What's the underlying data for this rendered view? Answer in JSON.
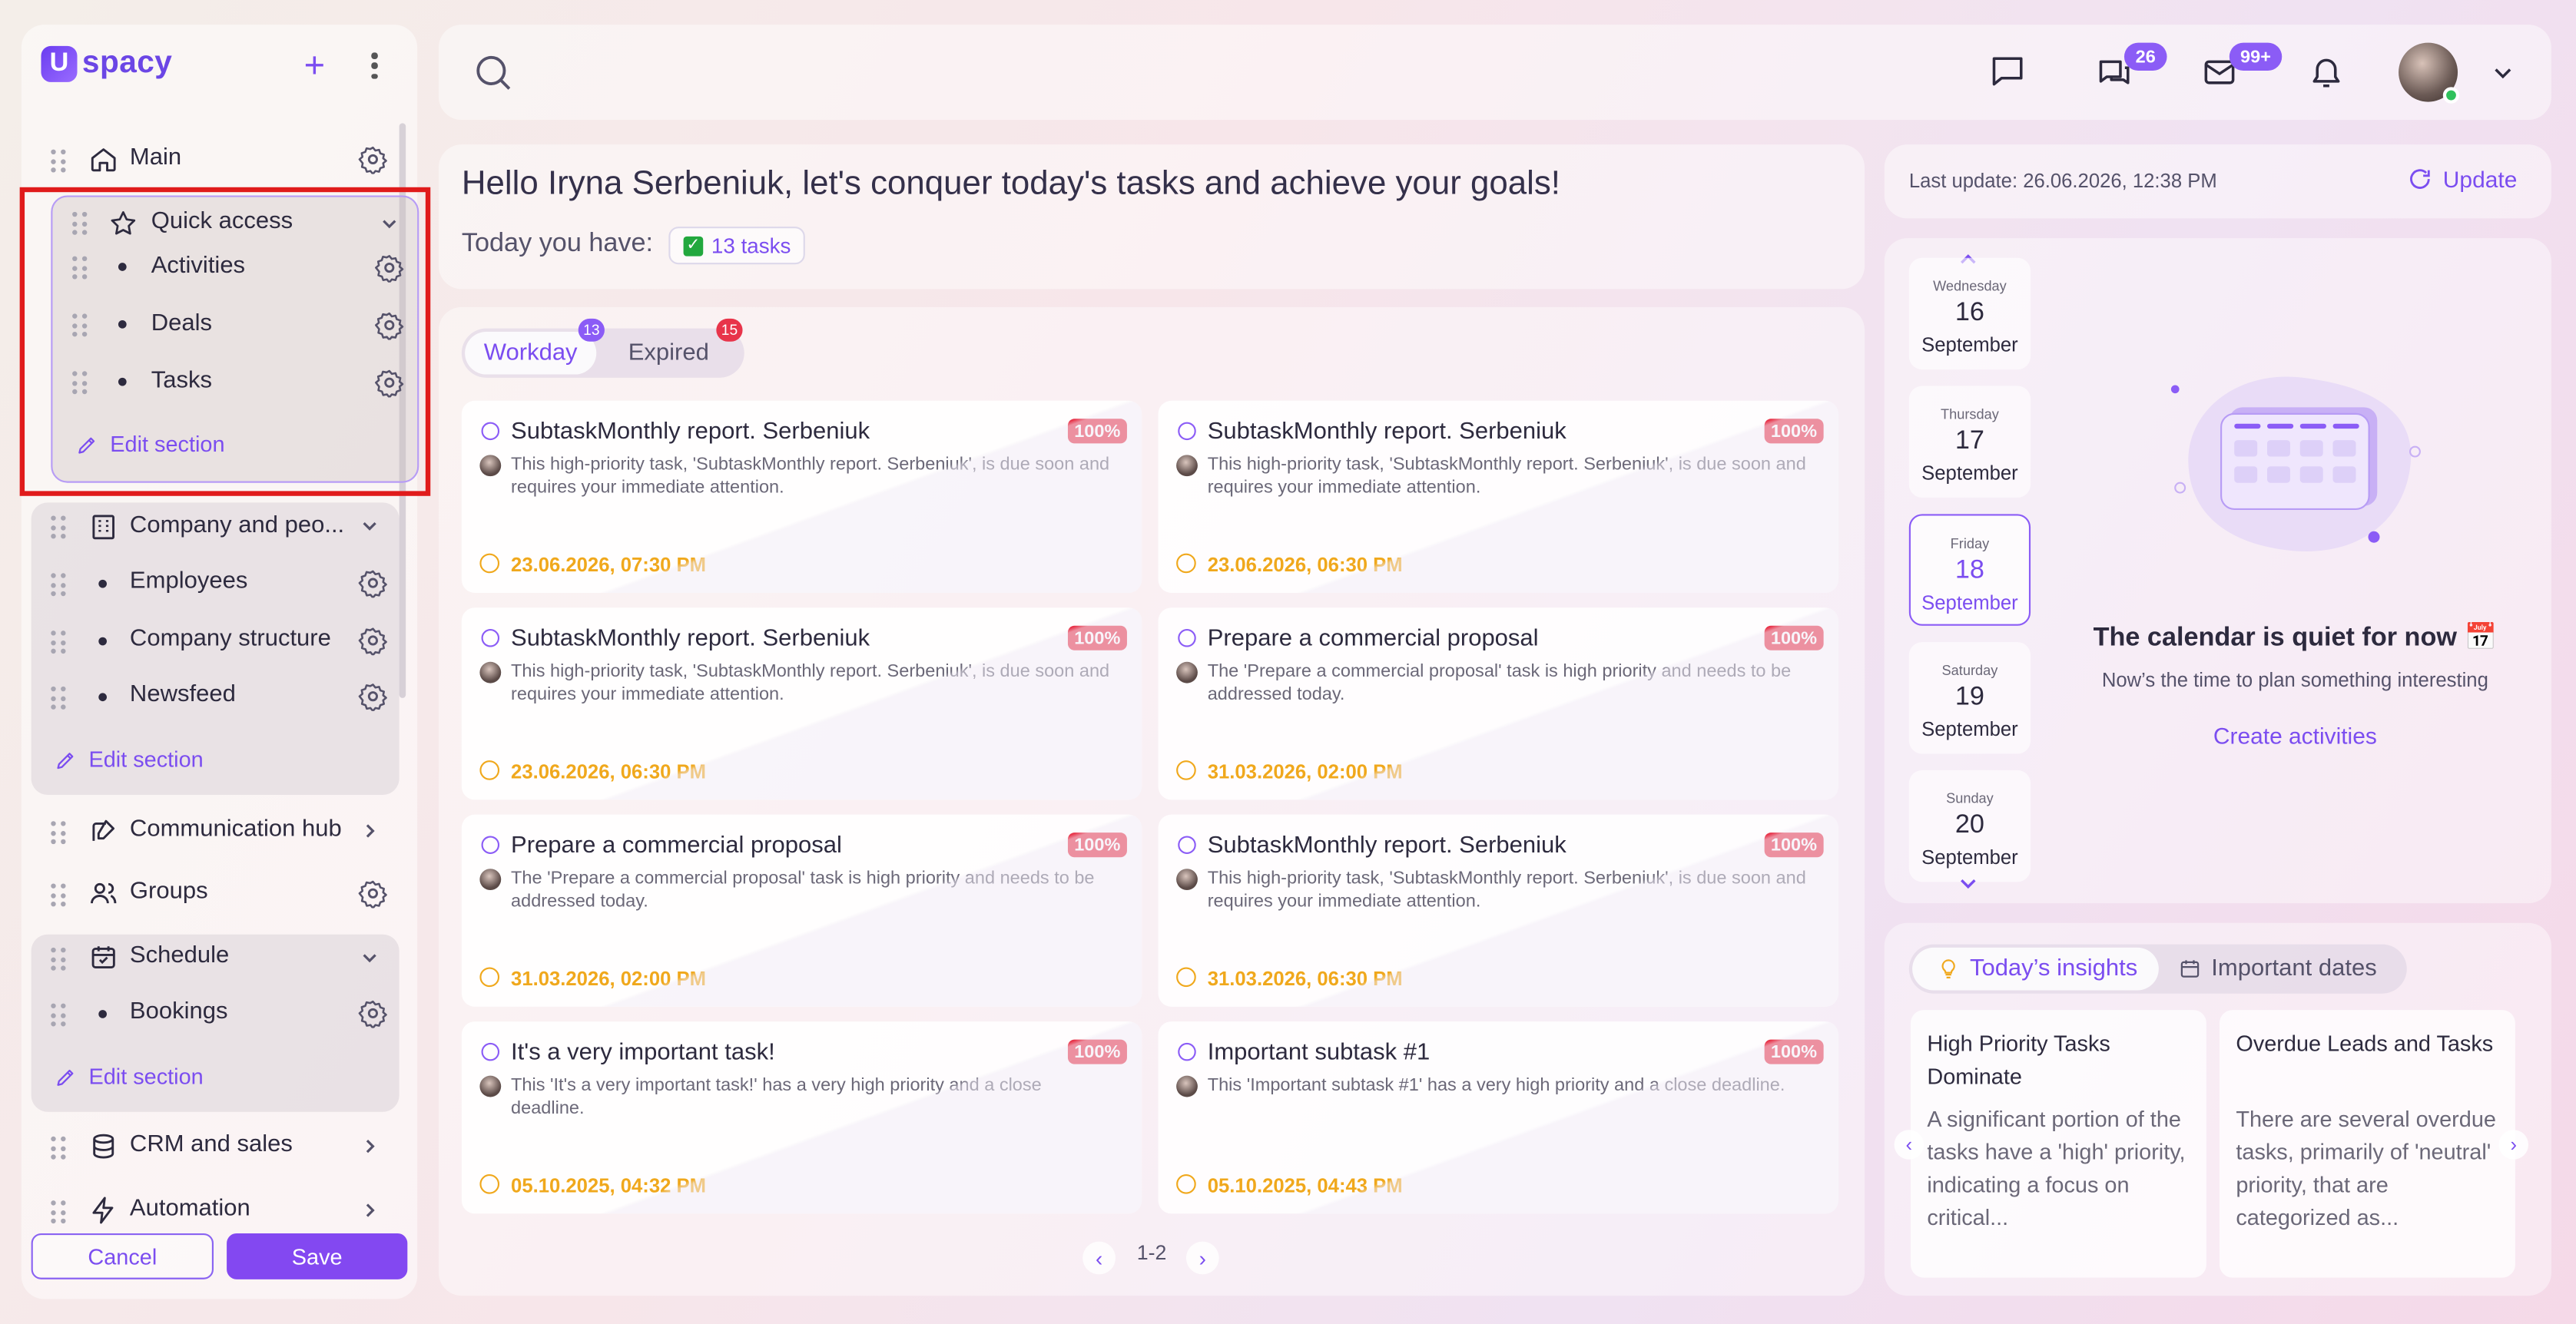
{
  "brand": {
    "logo_letter": "U",
    "logo_text": "spacy"
  },
  "sidebar": {
    "items": [
      {
        "label": "Main"
      },
      {
        "label": "Quick access",
        "children": [
          {
            "label": "Activities"
          },
          {
            "label": "Deals"
          },
          {
            "label": "Tasks"
          }
        ],
        "edit_label": "Edit section"
      },
      {
        "label": "Company and peo...",
        "children": [
          {
            "label": "Employees"
          },
          {
            "label": "Company structure"
          },
          {
            "label": "Newsfeed"
          }
        ],
        "edit_label": "Edit section"
      },
      {
        "label": "Communication hub"
      },
      {
        "label": "Groups"
      },
      {
        "label": "Schedule",
        "children": [
          {
            "label": "Bookings"
          }
        ],
        "edit_label": "Edit section"
      },
      {
        "label": "CRM and sales"
      },
      {
        "label": "Automation"
      }
    ],
    "cancel_label": "Cancel",
    "save_label": "Save"
  },
  "topbar": {
    "chat_badge": "26",
    "mail_badge": "99+"
  },
  "greeting": {
    "title": "Hello Iryna Serbeniuk, let's conquer today's tasks and achieve your goals!",
    "today_label": "Today you have:",
    "tasks_pill": "13 tasks"
  },
  "tasks": {
    "tabs": [
      {
        "label": "Workday",
        "badge": "13"
      },
      {
        "label": "Expired",
        "badge": "15"
      }
    ],
    "cards": [
      {
        "title": "SubtaskMonthly report. Serbeniuk",
        "percent": "100%",
        "desc": "This high-priority task, 'SubtaskMonthly report. Serbeniuk', is due soon and requires your immediate attention.",
        "date": "23.06.2026, 07:30 PM"
      },
      {
        "title": "SubtaskMonthly report. Serbeniuk",
        "percent": "100%",
        "desc": "This high-priority task, 'SubtaskMonthly report. Serbeniuk', is due soon and requires your immediate attention.",
        "date": "23.06.2026, 06:30 PM"
      },
      {
        "title": "SubtaskMonthly report. Serbeniuk",
        "percent": "100%",
        "desc": "This high-priority task, 'SubtaskMonthly report. Serbeniuk', is due soon and requires your immediate attention.",
        "date": "23.06.2026, 06:30 PM"
      },
      {
        "title": "Prepare a commercial proposal",
        "percent": "100%",
        "desc": "The 'Prepare a commercial proposal' task is high priority and needs to be addressed today.",
        "date": "31.03.2026, 02:00 PM"
      },
      {
        "title": "Prepare a commercial proposal",
        "percent": "100%",
        "desc": "The 'Prepare a commercial proposal' task is high priority and needs to be addressed today.",
        "date": "31.03.2026, 02:00 PM"
      },
      {
        "title": "SubtaskMonthly report. Serbeniuk",
        "percent": "100%",
        "desc": "This high-priority task, 'SubtaskMonthly report. Serbeniuk', is due soon and requires your immediate attention.",
        "date": "31.03.2026, 06:30 PM"
      },
      {
        "title": "It's a very important task!",
        "percent": "100%",
        "desc": "This 'It's a very important task!' has a very high priority and a close deadline.",
        "date": "05.10.2025, 04:32 PM"
      },
      {
        "title": "Important subtask #1",
        "percent": "100%",
        "desc": "This 'Important subtask #1' has a very high priority and a close deadline.",
        "date": "05.10.2025, 04:43 PM"
      }
    ],
    "pager": "1-2"
  },
  "update": {
    "last_update": "Last update: 26.06.2026, 12:38 PM",
    "button": "Update"
  },
  "calendar": {
    "days": [
      {
        "weekday": "Wednesday",
        "day": "16",
        "month": "September"
      },
      {
        "weekday": "Thursday",
        "day": "17",
        "month": "September"
      },
      {
        "weekday": "Friday",
        "day": "18",
        "month": "September"
      },
      {
        "weekday": "Saturday",
        "day": "19",
        "month": "September"
      },
      {
        "weekday": "Sunday",
        "day": "20",
        "month": "September"
      }
    ],
    "empty_title": "The calendar is quiet for now 📅",
    "empty_sub": "Now’s the time to plan something interesting",
    "create_link": "Create activities"
  },
  "insights": {
    "tabs": [
      {
        "label": "Today’s insights"
      },
      {
        "label": "Important dates"
      }
    ],
    "cards": [
      {
        "title": "High Priority Tasks Dominate",
        "body": "A significant portion of the tasks have a 'high' priority, indicating a focus on critical..."
      },
      {
        "title": "Overdue Leads and Tasks",
        "body": "There are several overdue tasks, primarily of 'neutral' priority, that are categorized as..."
      }
    ]
  },
  "colors": {
    "accent": "#8348f1",
    "danger": "#e8344a",
    "warning": "#f0a81c",
    "highlight": "#e01b1b"
  }
}
